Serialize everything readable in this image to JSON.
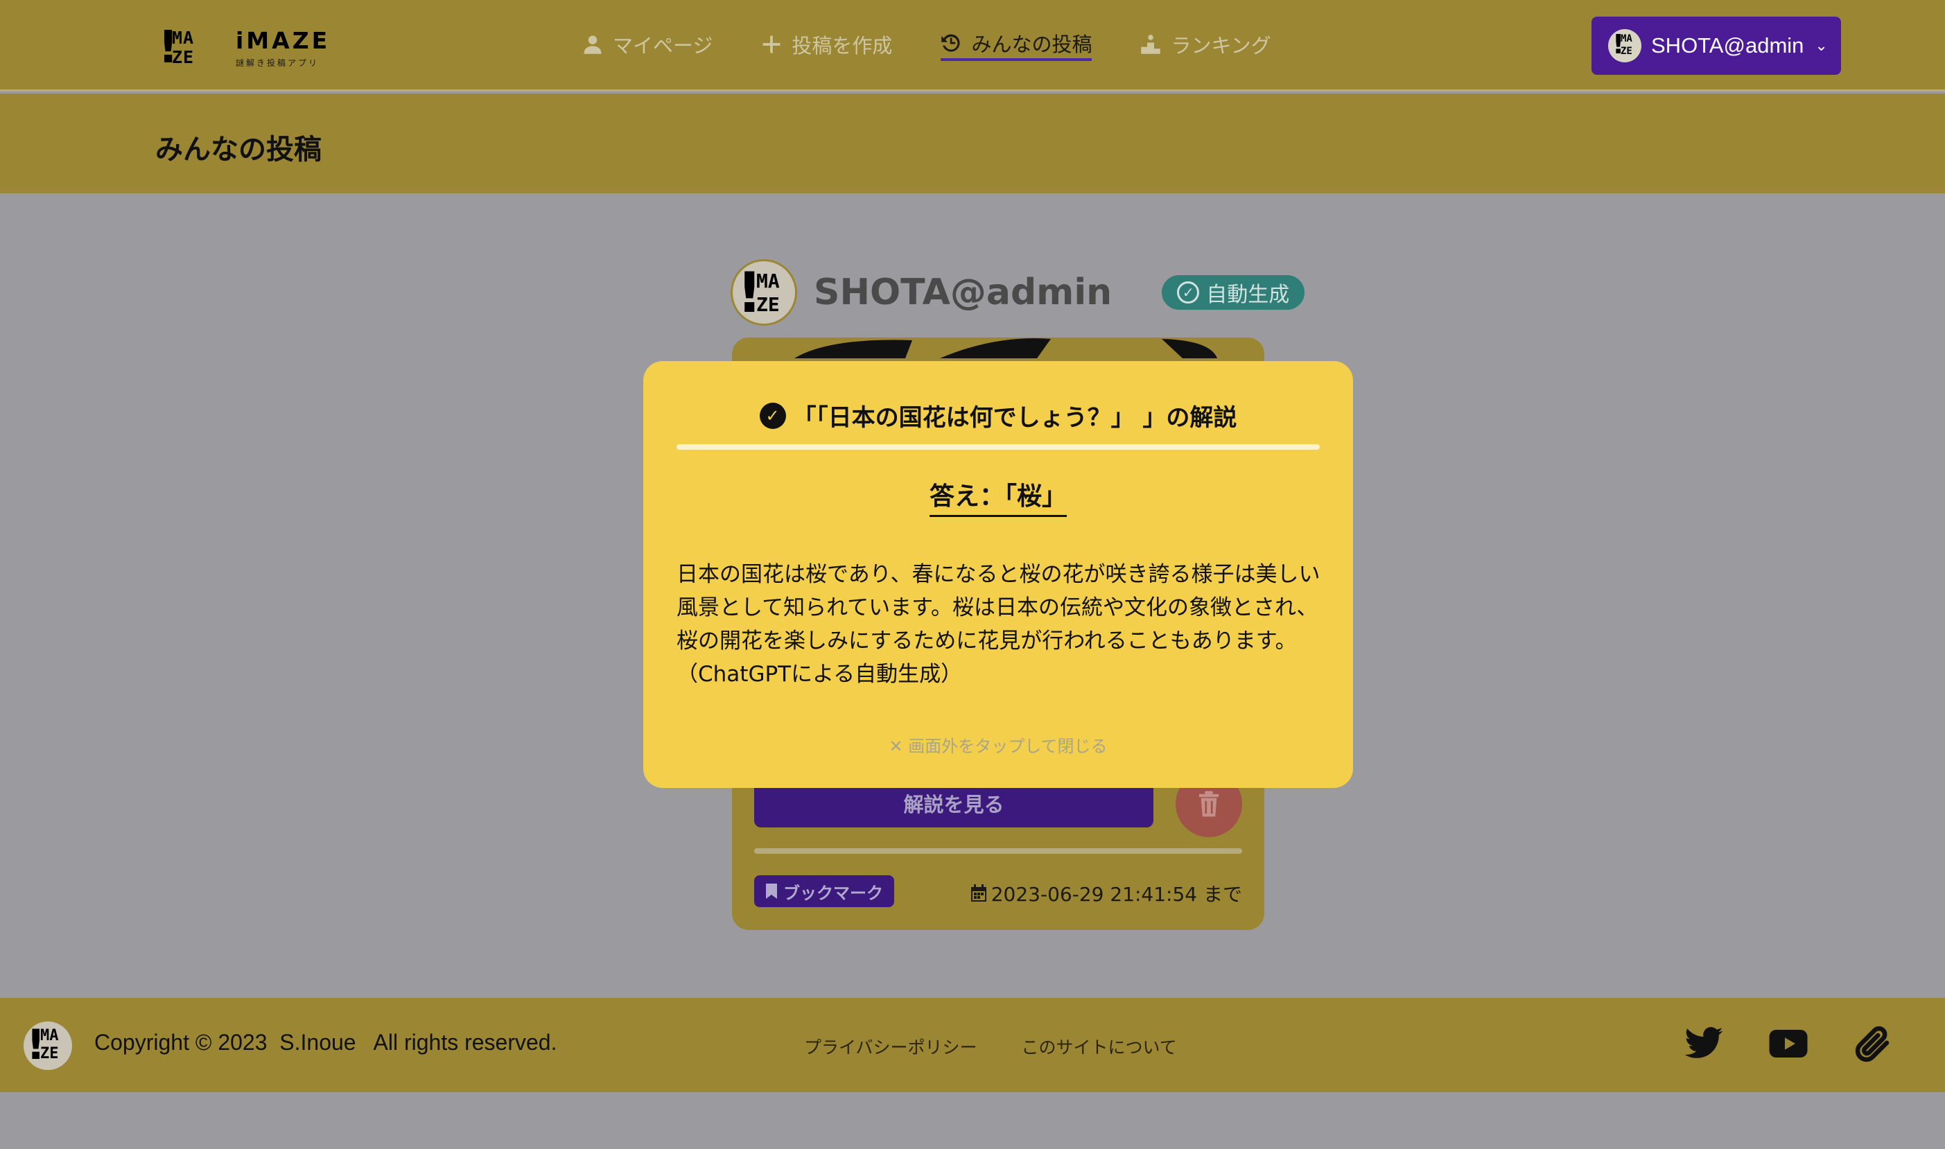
{
  "app": {
    "logo_title": "iMAZE",
    "logo_subtitle": "謎解き投稿アプリ"
  },
  "nav": {
    "items": [
      {
        "label": "マイページ",
        "icon": "user-icon",
        "active": false
      },
      {
        "label": "投稿を作成",
        "icon": "plus-icon",
        "active": false
      },
      {
        "label": "みんなの投稿",
        "icon": "history-icon",
        "active": true
      },
      {
        "label": "ランキング",
        "icon": "podium-icon",
        "active": false
      }
    ],
    "user_label": "SHOTA@admin"
  },
  "page": {
    "title": "みんなの投稿"
  },
  "post": {
    "author": "SHOTA@admin",
    "badge": "自動生成",
    "answer_button": "解説を見る",
    "bookmark": "ブックマーク",
    "deadline": "2023-06-29 21:41:54 まで"
  },
  "modal": {
    "title": "「「日本の国花は何でしょう？」 」の解説",
    "answer": "答え：「桜」",
    "body": "日本の国花は桜であり、春になると桜の花が咲き誇る様子は美しい風景として知られています。桜は日本の伝統や文化の象徴とされ、桜の開花を楽しみにするために花見が行われることもあります。（ChatGPTによる自動生成）",
    "close_hint": "画面外をタップして閉じる"
  },
  "footer": {
    "copyright": "Copyright © 2023  S.Inoue   All rights reserved.",
    "links": [
      "プライバシーポリシー",
      "このサイトについて"
    ],
    "icons": [
      "twitter-icon",
      "youtube-icon",
      "paperclip-icon"
    ]
  },
  "colors": {
    "header_bg": "#9b8634",
    "accent_purple": "#4c1c97",
    "modal_bg": "#f3cf4b",
    "badge_teal": "#2f7e77"
  }
}
